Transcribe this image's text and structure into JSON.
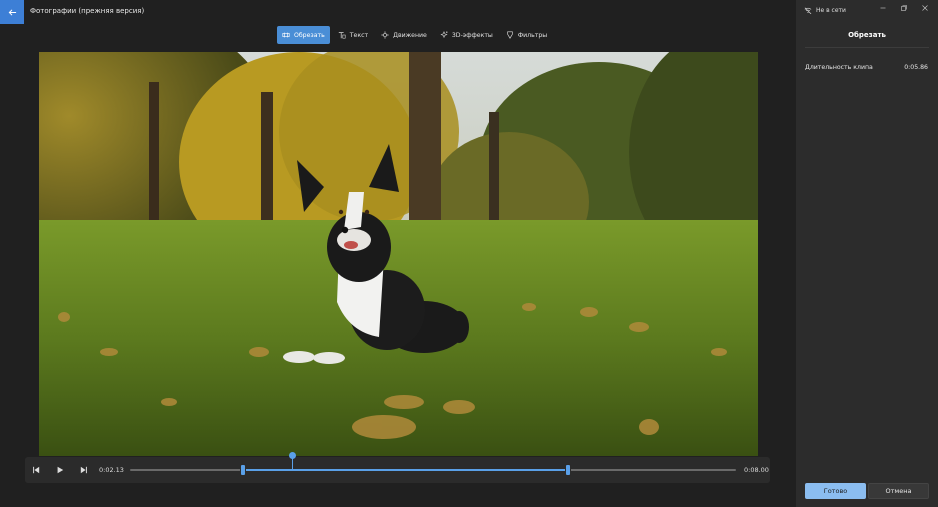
{
  "window": {
    "title": "Фотографии (прежняя версия)",
    "status": "Не в сети"
  },
  "toolbar": {
    "items": [
      {
        "label": "Обрезать",
        "icon": "trim-icon",
        "active": true
      },
      {
        "label": "Текст",
        "icon": "text-icon",
        "active": false
      },
      {
        "label": "Движение",
        "icon": "motion-icon",
        "active": false
      },
      {
        "label": "3D-эффекты",
        "icon": "3d-effects-icon",
        "active": false
      },
      {
        "label": "Фильтры",
        "icon": "filters-icon",
        "active": false
      }
    ]
  },
  "preview": {
    "icon": "photo-preview-dog-on-grass"
  },
  "playback": {
    "current_time": "0:02.13",
    "end_time": "0:08.00",
    "trim_start_fraction": 0.186,
    "trim_end_fraction": 0.723,
    "playhead_fraction": 0.268
  },
  "panel": {
    "title": "Обрезать",
    "clip_length_label": "Длительность клипа",
    "clip_length_value": "0:05.86",
    "done_label": "Готово",
    "cancel_label": "Отмена"
  },
  "colors": {
    "accent": "#4a8ed6",
    "done_button": "#8bbdf0",
    "background": "#202020",
    "panel": "#2c2c2c"
  }
}
